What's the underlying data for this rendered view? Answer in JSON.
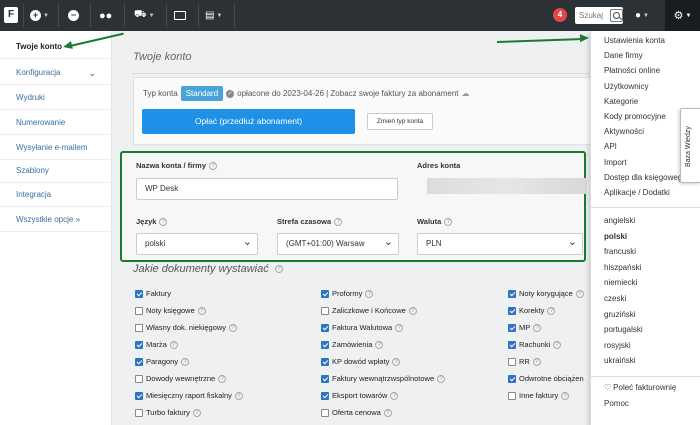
{
  "topbar": {
    "logo": "F",
    "search_placeholder": "Szukaj",
    "notification_count": "4"
  },
  "sidebar": {
    "items": [
      {
        "label": "Twoje konto"
      },
      {
        "label": "Konfiguracja"
      },
      {
        "label": "Wydruki"
      },
      {
        "label": "Numerowanie"
      },
      {
        "label": "Wysyłanie e-mailem"
      },
      {
        "label": "Szablony"
      },
      {
        "label": "Integracja"
      },
      {
        "label": "Wszystkie opcje »"
      }
    ]
  },
  "main": {
    "title": "Twoje konto",
    "plan": {
      "type_label": "Typ konta",
      "type_value": "Standard",
      "paid_text": "opłacone do 2023-04-26 | Zobacz swoje faktury za abonament",
      "pay_button": "Opłać (przedłuż abonament)",
      "change_button": "Zmień typ konta"
    },
    "form": {
      "account_name_label": "Nazwa konta / firmy",
      "account_name_value": "WP Desk",
      "address_label": "Adres konta",
      "language_label": "Język",
      "language_value": "polski",
      "timezone_label": "Strefa czasowa",
      "timezone_value": "(GMT+01:00) Warsaw",
      "currency_label": "Waluta",
      "currency_value": "PLN"
    },
    "documents": {
      "title": "Jakie dokumenty wystawiać",
      "col1": [
        {
          "label": "Faktury",
          "checked": true
        },
        {
          "label": "Noty księgowe",
          "checked": false
        },
        {
          "label": "Własny dok. niekięgowy",
          "checked": false
        },
        {
          "label": "Marża",
          "checked": true
        },
        {
          "label": "Paragony",
          "checked": true
        },
        {
          "label": "Dowody wewnętrzne",
          "checked": false
        },
        {
          "label": "Miesięczny raport fiskalny",
          "checked": true
        },
        {
          "label": "Turbo faktury",
          "checked": false
        }
      ],
      "col2": [
        {
          "label": "Proformy",
          "checked": true
        },
        {
          "label": "Zaliczkowe i Końcowe",
          "checked": false
        },
        {
          "label": "Faktura Walutowa",
          "checked": true
        },
        {
          "label": "Zamówienia",
          "checked": true
        },
        {
          "label": "KP dowód wpłaty",
          "checked": true
        },
        {
          "label": "Faktury wewnątrzwspólnotowe",
          "checked": true
        },
        {
          "label": "Eksport towarów",
          "checked": true
        },
        {
          "label": "Oferta cenowa",
          "checked": false
        }
      ],
      "col3": [
        {
          "label": "Noty korygujące",
          "checked": true
        },
        {
          "label": "Korekty",
          "checked": true
        },
        {
          "label": "MP",
          "checked": true
        },
        {
          "label": "Rachunki",
          "checked": true
        },
        {
          "label": "RR",
          "checked": false
        },
        {
          "label": "Odwrotne obciążen",
          "checked": true
        },
        {
          "label": "Inne faktury",
          "checked": false
        }
      ]
    }
  },
  "dropdown": {
    "settings": [
      {
        "label": "Ustawienia konta"
      },
      {
        "label": "Dane firmy"
      },
      {
        "label": "Płatności online"
      },
      {
        "label": "Użytkownicy"
      },
      {
        "label": "Kategorie"
      },
      {
        "label": "Kody promocyjne"
      },
      {
        "label": "Aktywności"
      },
      {
        "label": "API"
      },
      {
        "label": "Import"
      },
      {
        "label": "Dostęp dla księgowego"
      },
      {
        "label": "Aplikacje / Dodatki"
      }
    ],
    "languages": [
      {
        "label": "angielski"
      },
      {
        "label": "polski"
      },
      {
        "label": "francuski"
      },
      {
        "label": "hiszpański"
      },
      {
        "label": "niemiecki"
      },
      {
        "label": "czeski"
      },
      {
        "label": "gruziński"
      },
      {
        "label": "portugalski"
      },
      {
        "label": "rosyjski"
      },
      {
        "label": "ukraiński"
      }
    ],
    "recommend": "Poleć fakturownię",
    "help": "Pomoc"
  },
  "knowledge_base": "Baza Wiedzy",
  "colors": {
    "topbar": "#2c3136",
    "accent_blue": "#1e90e8",
    "annotation_green": "#1a7a2e",
    "badge_red": "#e0474c"
  }
}
